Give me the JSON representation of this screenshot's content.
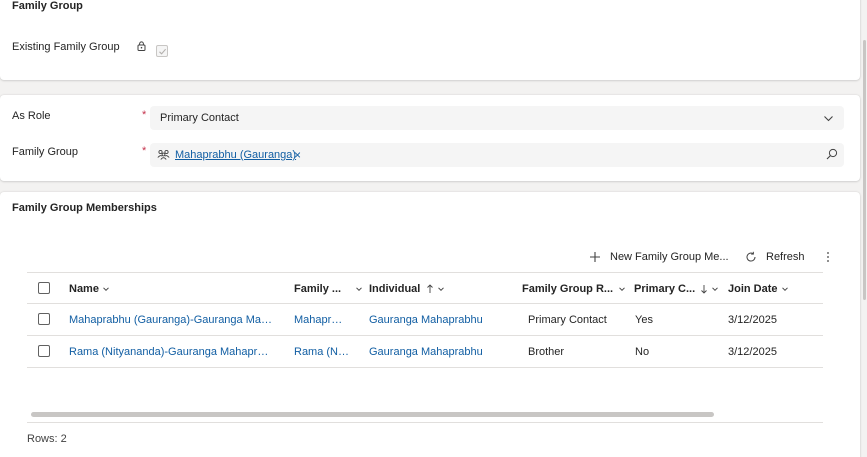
{
  "family_group_section": {
    "title": "Family Group",
    "existing_label": "Existing Family Group",
    "existing_checked": true
  },
  "form": {
    "as_role_label": "As Role",
    "as_role_value": "Primary Contact",
    "family_group_label": "Family Group",
    "family_group_value": "Mahaprabhu (Gauranga)",
    "required_mark": "*"
  },
  "memberships": {
    "title": "Family Group Memberships",
    "toolbar": {
      "new_label": "New Family Group Me...",
      "refresh_label": "Refresh"
    },
    "columns": [
      "Name",
      "Family ...",
      "Individual",
      "Family Group R...",
      "Primary C...",
      "Join Date"
    ],
    "rows": [
      {
        "name": "Mahaprabhu (Gauranga)-Gauranga Maha...",
        "family": "Mahapra...",
        "individual": "Gauranga Mahaprabhu",
        "role": "Primary Contact",
        "primary": "Yes",
        "join_date": "3/12/2025"
      },
      {
        "name": "Rama (Nityananda)-Gauranga Mahaprabh...",
        "family": "Rama (Nit...",
        "individual": "Gauranga Mahaprabhu",
        "role": "Brother",
        "primary": "No",
        "join_date": "3/12/2025"
      }
    ],
    "rows_count": "Rows: 2"
  }
}
